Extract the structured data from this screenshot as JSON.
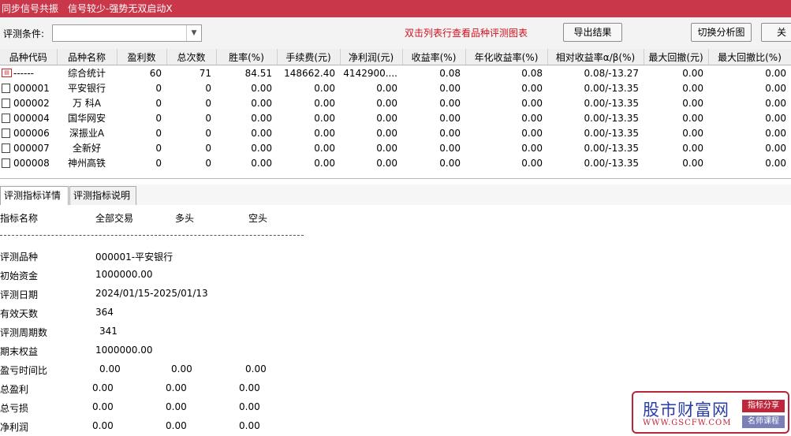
{
  "titlebar": {
    "app_title": "同步信号共振",
    "subtitle": "信号较少-强势无双启动X"
  },
  "toolbar": {
    "criteria_label": "评测条件:",
    "criteria_value": "",
    "hint_text": "双击列表行查看品种评测图表",
    "export_button": "导出结果",
    "switch_chart_button": "切换分析图",
    "close_button": "关"
  },
  "grid": {
    "columns": [
      "品种代码",
      "品种名称",
      "盈利数",
      "总次数",
      "胜率(%)",
      "手续费(元)",
      "净利润(元)",
      "收益率(%)",
      "年化收益率(%)",
      "相对收益率α/β(%)",
      "最大回撤(元)",
      "最大回撤比(%)"
    ],
    "summary_row": {
      "code": "------",
      "name": "综合统计",
      "values": [
        "60",
        "71",
        "84.51",
        "148662.40",
        "4142900....",
        "0.08",
        "0.08",
        "0.08/-13.27",
        "0.00",
        "0.00"
      ]
    },
    "rows": [
      {
        "code": "000001",
        "name": "平安银行",
        "values": [
          "0",
          "0",
          "0.00",
          "0.00",
          "0.00",
          "0.00",
          "0.00",
          "0.00/-13.35",
          "0.00",
          "0.00"
        ]
      },
      {
        "code": "000002",
        "name": "万 科A",
        "values": [
          "0",
          "0",
          "0.00",
          "0.00",
          "0.00",
          "0.00",
          "0.00",
          "0.00/-13.35",
          "0.00",
          "0.00"
        ]
      },
      {
        "code": "000004",
        "name": "国华网安",
        "values": [
          "0",
          "0",
          "0.00",
          "0.00",
          "0.00",
          "0.00",
          "0.00",
          "0.00/-13.35",
          "0.00",
          "0.00"
        ]
      },
      {
        "code": "000006",
        "name": "深振业A",
        "values": [
          "0",
          "0",
          "0.00",
          "0.00",
          "0.00",
          "0.00",
          "0.00",
          "0.00/-13.35",
          "0.00",
          "0.00"
        ]
      },
      {
        "code": "000007",
        "name": "全新好",
        "values": [
          "0",
          "0",
          "0.00",
          "0.00",
          "0.00",
          "0.00",
          "0.00",
          "0.00/-13.35",
          "0.00",
          "0.00"
        ]
      },
      {
        "code": "000008",
        "name": "神州高铁",
        "values": [
          "0",
          "0",
          "0.00",
          "0.00",
          "0.00",
          "0.00",
          "0.00",
          "0.00/-13.35",
          "0.00",
          "0.00"
        ]
      }
    ]
  },
  "tabs": [
    "评测指标详情",
    "评测指标说明"
  ],
  "detail": {
    "headers": {
      "name": "指标名称",
      "all": "全部交易",
      "long": "多头",
      "short": "空头"
    },
    "separator": "------------------------------------------------------------------------",
    "single_rows": [
      {
        "label": "评测品种",
        "value": "000001-平安银行"
      },
      {
        "label": "初始资金",
        "value": "1000000.00"
      },
      {
        "label": "评测日期",
        "value": "2024/01/15-2025/01/13"
      },
      {
        "label": "有效天数",
        "value": "364"
      },
      {
        "label": "评测周期数",
        "value": "341"
      },
      {
        "label": "期末权益",
        "value": "1000000.00"
      }
    ],
    "triple_rows": [
      {
        "label": "盈亏时间比",
        "all": "0.00",
        "long": "0.00",
        "short": "0.00"
      },
      {
        "label": "总盈利",
        "all": "0.00",
        "long": "0.00",
        "short": "0.00"
      },
      {
        "label": "总亏损",
        "all": "0.00",
        "long": "0.00",
        "short": "0.00"
      },
      {
        "label": "净利润",
        "all": "0.00",
        "long": "0.00",
        "short": "0.00"
      }
    ]
  },
  "watermark": {
    "title": "股市财富网",
    "url": "WWW.GSCFW.COM",
    "tag1": "指标分享",
    "tag2": "名师课程"
  }
}
